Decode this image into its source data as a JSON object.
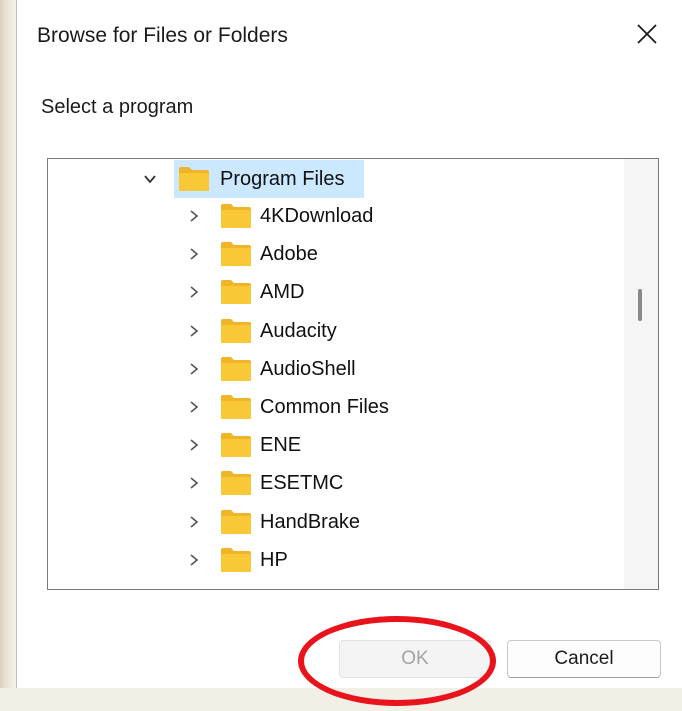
{
  "dialog": {
    "title": "Browse for Files or Folders",
    "prompt": "Select a program"
  },
  "tree": {
    "root": {
      "label": "Program Files",
      "expanded": true,
      "selected": true
    },
    "children": [
      {
        "label": "4KDownload"
      },
      {
        "label": "Adobe"
      },
      {
        "label": "AMD"
      },
      {
        "label": "Audacity"
      },
      {
        "label": "AudioShell"
      },
      {
        "label": "Common Files"
      },
      {
        "label": "ENE"
      },
      {
        "label": "ESETMC"
      },
      {
        "label": "HandBrake"
      },
      {
        "label": "HP"
      }
    ]
  },
  "buttons": {
    "ok_label": "OK",
    "ok_disabled": true,
    "cancel_label": "Cancel"
  },
  "colors": {
    "selection": "#cce8ff",
    "folder": "#f8c836",
    "annotation": "#e8131b"
  }
}
